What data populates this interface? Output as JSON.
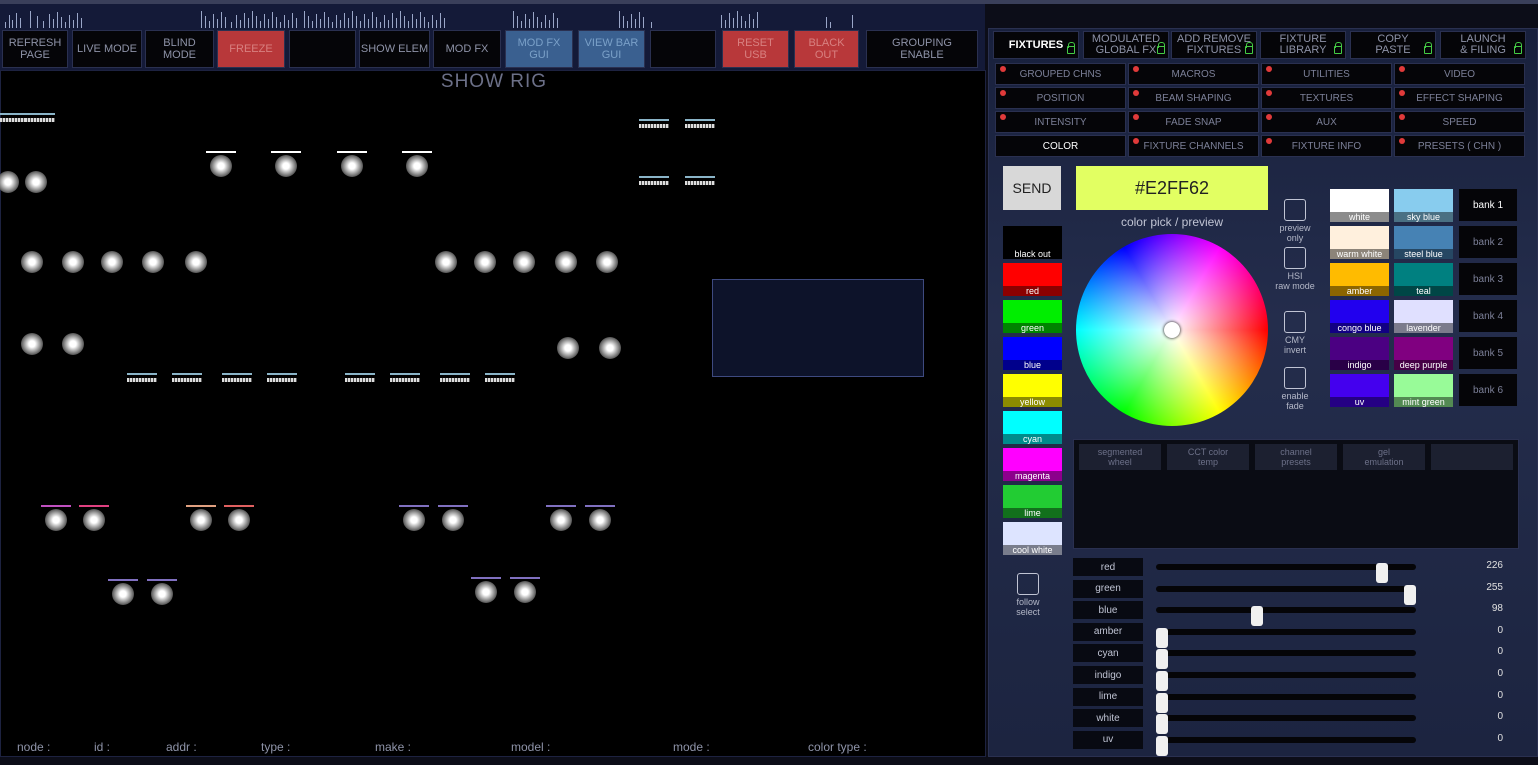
{
  "toolbar": {
    "buttons": [
      {
        "label": "REFRESH\nPAGE",
        "style": ""
      },
      {
        "label": "LIVE MODE",
        "style": ""
      },
      {
        "label": "BLIND MODE",
        "style": ""
      },
      {
        "label": "FREEZE",
        "style": "red"
      },
      {
        "label": "",
        "style": ""
      },
      {
        "label": "SHOW ELEM",
        "style": ""
      },
      {
        "label": "MOD FX",
        "style": ""
      },
      {
        "label": "MOD FX\nGUI",
        "style": "blue"
      },
      {
        "label": "VIEW BAR\nGUI",
        "style": "blue"
      },
      {
        "label": "",
        "style": ""
      },
      {
        "label": "RESET\nUSB",
        "style": "red"
      },
      {
        "label": "BLACK\nOUT",
        "style": "red"
      },
      {
        "label": "GROUPING\nENABLE",
        "style": ""
      }
    ]
  },
  "rig": {
    "title": "SHOW RIG",
    "info_labels": [
      "node :",
      "id :",
      "addr :",
      "type :",
      "make :",
      "model :",
      "mode :",
      "color type :"
    ]
  },
  "panel": {
    "tabs": [
      {
        "label": "FIXTURES",
        "active": true
      },
      {
        "label": "MODULATED\nGLOBAL FX",
        "active": false
      },
      {
        "label": "ADD REMOVE\nFIXTURES",
        "active": false
      },
      {
        "label": "FIXTURE\nLIBRARY",
        "active": false
      },
      {
        "label": "COPY\nPASTE",
        "active": false
      },
      {
        "label": "LAUNCH\n& FILING",
        "active": false
      }
    ],
    "categories": [
      {
        "label": "GROUPED CHNS",
        "active": false
      },
      {
        "label": "MACROS",
        "active": false
      },
      {
        "label": "UTILITIES",
        "active": false
      },
      {
        "label": "VIDEO",
        "active": false
      },
      {
        "label": "POSITION",
        "active": false
      },
      {
        "label": "BEAM SHAPING",
        "active": false
      },
      {
        "label": "TEXTURES",
        "active": false
      },
      {
        "label": "EFFECT SHAPING",
        "active": false
      },
      {
        "label": "INTENSITY",
        "active": false
      },
      {
        "label": "FADE SNAP",
        "active": false
      },
      {
        "label": "AUX",
        "active": false
      },
      {
        "label": "SPEED",
        "active": false
      },
      {
        "label": "COLOR",
        "active": true
      },
      {
        "label": "FIXTURE CHANNELS",
        "active": false
      },
      {
        "label": "FIXTURE INFO",
        "active": false
      },
      {
        "label": "PRESETS ( CHN )",
        "active": false
      }
    ],
    "send_label": "SEND",
    "hex_value": "#E2FF62",
    "hex_color": "#e2ff62",
    "color_pick_label": "color pick / preview",
    "options": [
      "preview\nonly",
      "HSI\nraw mode",
      "CMY\ninvert",
      "enable\nfade"
    ],
    "left_swatches": [
      {
        "label": "black out",
        "color": "#000000"
      },
      {
        "label": "red",
        "color": "#ff0000"
      },
      {
        "label": "green",
        "color": "#00ee00"
      },
      {
        "label": "blue",
        "color": "#0000ff"
      },
      {
        "label": "yellow",
        "color": "#ffff00"
      },
      {
        "label": "cyan",
        "color": "#00ffff"
      },
      {
        "label": "magenta",
        "color": "#ff00ff"
      },
      {
        "label": "lime",
        "color": "#22cc33"
      },
      {
        "label": "cool white",
        "color": "#dde4ff"
      }
    ],
    "right_swatches": [
      {
        "label": "white",
        "color": "#ffffff"
      },
      {
        "label": "sky blue",
        "color": "#88ccee"
      },
      {
        "label": "warm white",
        "color": "#fff0dd"
      },
      {
        "label": "steel blue",
        "color": "#4682b4"
      },
      {
        "label": "amber",
        "color": "#ffbb00"
      },
      {
        "label": "teal",
        "color": "#008080"
      },
      {
        "label": "congo blue",
        "color": "#2200ee"
      },
      {
        "label": "lavender",
        "color": "#e0e0ff"
      },
      {
        "label": "indigo",
        "color": "#4b0082"
      },
      {
        "label": "deep purple",
        "color": "#800080"
      },
      {
        "label": "uv",
        "color": "#4400ee"
      },
      {
        "label": "mint green",
        "color": "#98fb98"
      }
    ],
    "banks": [
      {
        "label": "bank 1",
        "active": true
      },
      {
        "label": "bank 2",
        "active": false
      },
      {
        "label": "bank 3",
        "active": false
      },
      {
        "label": "bank 4",
        "active": false
      },
      {
        "label": "bank 5",
        "active": false
      },
      {
        "label": "bank 6",
        "active": false
      }
    ],
    "tools": [
      "segmented\nwheel",
      "CCT color\ntemp",
      "channel\npresets",
      "gel\nemulation",
      ""
    ],
    "follow_label": "follow\nselect",
    "sliders": [
      {
        "name": "red",
        "value": 226
      },
      {
        "name": "green",
        "value": 255
      },
      {
        "name": "blue",
        "value": 98
      },
      {
        "name": "amber",
        "value": 0
      },
      {
        "name": "cyan",
        "value": 0
      },
      {
        "name": "indigo",
        "value": 0
      },
      {
        "name": "lime",
        "value": 0
      },
      {
        "name": "white",
        "value": 0
      },
      {
        "name": "uv",
        "value": 0
      }
    ]
  }
}
